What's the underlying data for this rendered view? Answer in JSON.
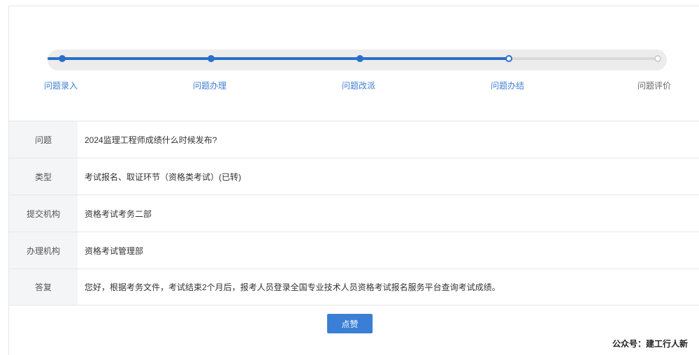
{
  "progress": {
    "steps": [
      {
        "label": "问题录入",
        "state": "done"
      },
      {
        "label": "问题办理",
        "state": "done"
      },
      {
        "label": "问题改派",
        "state": "done"
      },
      {
        "label": "问题办结",
        "state": "current"
      },
      {
        "label": "问题评价",
        "state": "todo"
      }
    ],
    "accent_color": "#2a6fc9"
  },
  "details": {
    "rows": [
      {
        "key": "问题",
        "value": "2024监理工程师成绩什么时候发布?"
      },
      {
        "key": "类型",
        "value": "考试报名、取证环节（资格类考试）(已转)"
      },
      {
        "key": "提交机构",
        "value": "资格考试考务二部"
      },
      {
        "key": "办理机构",
        "value": "资格考试管理部"
      },
      {
        "key": "答复",
        "value": "您好，根据考务文件，考试结束2个月后，报考人员登录全国专业技术人员资格考试报名服务平台查询考试成绩。"
      }
    ]
  },
  "like_button": {
    "label": "点赞",
    "color": "#3a7fd5"
  },
  "watermark": {
    "text": "公众号：建工行人新"
  }
}
